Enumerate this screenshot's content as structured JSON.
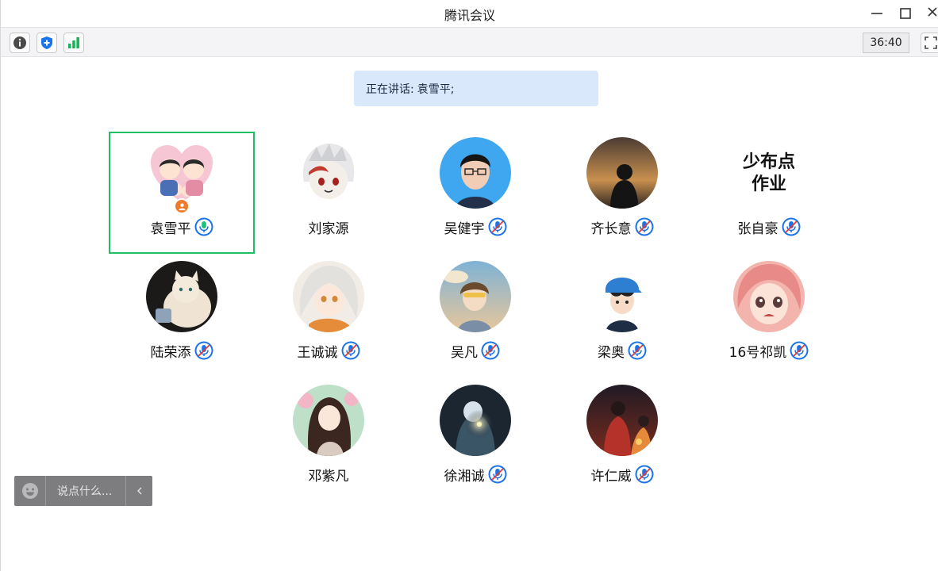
{
  "window": {
    "title": "腾讯会议"
  },
  "toolbar": {
    "timer": "36:40"
  },
  "banner": {
    "label": "正在讲话:",
    "speaker": "袁雪平;"
  },
  "participants": [
    {
      "name": "袁雪平",
      "mic": "active",
      "host": true
    },
    {
      "name": "刘家源",
      "mic": "none"
    },
    {
      "name": "吴健宇",
      "mic": "muted"
    },
    {
      "name": "齐长意",
      "mic": "muted"
    },
    {
      "name": "张自豪",
      "mic": "muted",
      "avatar_text": [
        "少布点",
        "作业"
      ]
    },
    {
      "name": "陆荣添",
      "mic": "muted"
    },
    {
      "name": "王诚诚",
      "mic": "muted"
    },
    {
      "name": "吴凡",
      "mic": "muted"
    },
    {
      "name": "梁奥",
      "mic": "muted"
    },
    {
      "name": "16号祁凯",
      "mic": "muted"
    },
    {
      "name": "邓紫凡",
      "mic": "none"
    },
    {
      "name": "徐湘诚",
      "mic": "muted"
    },
    {
      "name": "许仁威",
      "mic": "muted"
    }
  ],
  "chat": {
    "placeholder": "说点什么..."
  },
  "colors": {
    "active_border": "#1fbf63",
    "mic_blue": "#1a73e8",
    "banner_bg": "#d9e8fb",
    "host_badge": "#f07a2c"
  }
}
